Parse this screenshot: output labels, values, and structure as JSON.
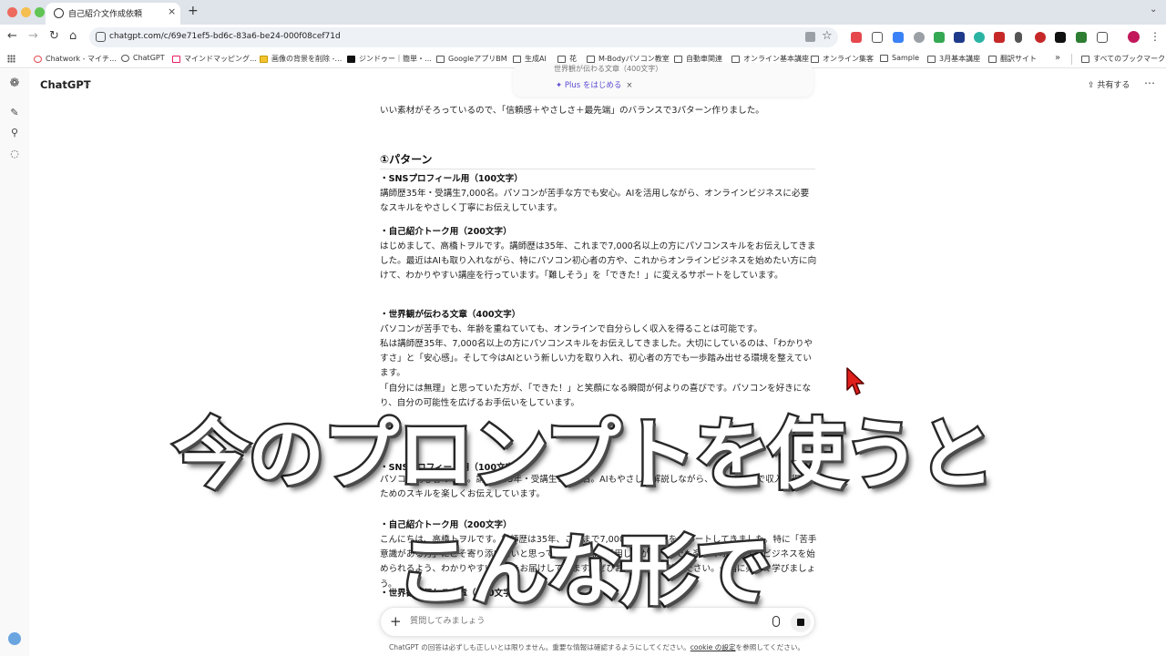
{
  "browser": {
    "tab_title": "自己紹介文作成依頼",
    "url": "chatgpt.com/c/69e71ef5-bd6c-83a6-be24-000f08cef71d",
    "bookmarks": [
      "Chatwork - マイチ…",
      "ChatGPT",
      "マインドマッピング…",
      "画像の背景を削除 -…",
      "ジンドゥー｜簡単・…",
      "GoogleアプリBM",
      "生成AI",
      "花",
      "M-Bodyパソコン教室",
      "自動車関連",
      "オンライン基本講座",
      "オンライン集客",
      "Sample",
      "3月基本講座",
      "翻訳サイト"
    ],
    "all_bookmarks": "すべてのブックマーク",
    "colors": {
      "chrome_bg": "#dfe3ea",
      "close": "#ed6a5e",
      "minimize": "#f5bf4f",
      "maximize": "#61c554",
      "profile": "#c2185b"
    }
  },
  "app": {
    "title": "ChatGPT",
    "share_label": "共有する",
    "promo": {
      "top_text": "世界観が伝わる文章（400文字）",
      "pill": "Plus をはじめる"
    }
  },
  "message": {
    "intro": "いい素材がそろっているので、「信頼感＋やさしさ＋最先端」のバランスで3パターン作りました。",
    "pattern1": {
      "heading": "①パターン",
      "sns_title": "・SNSプロフィール用（100文字）",
      "sns_body": "講師歴35年・受講生7,000名。パソコンが苦手な方でも安心。AIを活用しながら、オンラインビジネスに必要なスキルをやさしく丁寧にお伝えしています。",
      "talk_title": "・自己紹介トーク用（200文字）",
      "talk_body": "はじめまして、高橋トヲルです。講師歴は35年、これまで7,000名以上の方にパソコンスキルをお伝えしてきました。最近はAIも取り入れながら、特にパソコン初心者の方や、これからオンラインビジネスを始めたい方に向けて、わかりやすい講座を行っています。「難しそう」を「できた！」に変えるサポートをしています。",
      "world_title": "・世界観が伝わる文章（400文字）",
      "world_p1": "パソコンが苦手でも、年齢を重ねていても、オンラインで自分らしく収入を得ることは可能です。",
      "world_p2": "私は講師歴35年、7,000名以上の方にパソコンスキルをお伝えしてきました。大切にしているのは、「わかりやすさ」と「安心感」。そして今はAIという新しい力を取り入れ、初心者の方でも一歩踏み出せる環境を整えています。",
      "world_p3": "「自分には無理」と思っていた方が、「できた！」と笑顔になる瞬間が何よりの喜びです。パソコンを好きになり、自分の可能性を広げるお手伝いをしています。"
    },
    "pattern2": {
      "sns_title": "・SNSプロフィール用（100文字）",
      "sns_body": "パソコン初心者の味方。講師歴35年・受講生7,000名。AIもやさしく解説しながら、オンラインで収入を得るためのスキルを楽しくお伝えしています。",
      "talk_title": "・自己紹介トーク用（200文字）",
      "talk_body": "こんにちは、高橋トヲルです。講師歴は35年、これまで7,000名以上の方をサポートしてきました。特に「苦手意識がある方」にこそ寄り添いたいと思っています。AIも活用しながら、誰でも楽しくオンラインビジネスを始められるよう、わかりやすい講座をお届けしています。ぜひお気軽にご相談ください。一緒に楽しく学びましょう。",
      "world_title": "・世界観が伝わる文章（400文字）"
    }
  },
  "composer": {
    "placeholder": "質問してみましょう",
    "disclaimer_pre": "ChatGPT の回答は必ずしも正しいとは限りません。重要な情報は確認するようにしてください。",
    "disclaimer_link": "cookie の設定",
    "disclaimer_post": "を参照してください。"
  },
  "overlay": {
    "caption_line1": "今のプロンプトを使うと",
    "caption_line2": "こんな形で"
  }
}
